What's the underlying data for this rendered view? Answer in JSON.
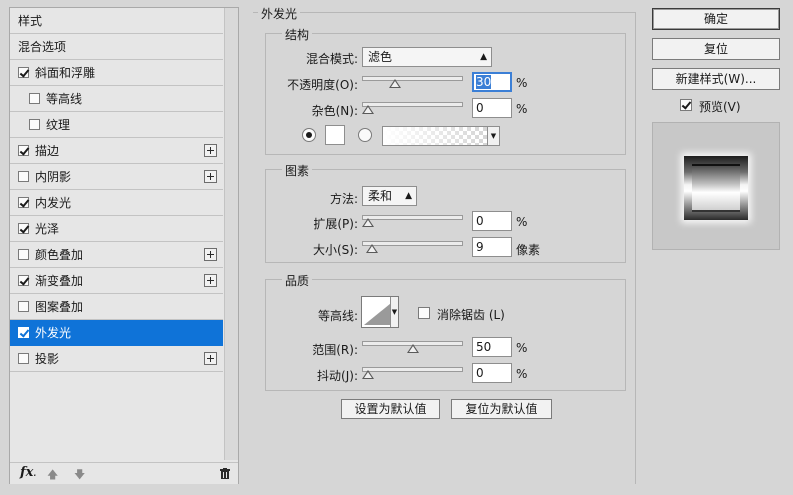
{
  "left_panel": {
    "items": [
      {
        "label": "样式",
        "has_checkbox": false,
        "checked": false,
        "has_plus": false,
        "indent": false,
        "selected": false
      },
      {
        "label": "混合选项",
        "has_checkbox": false,
        "checked": false,
        "has_plus": false,
        "indent": false,
        "selected": false
      },
      {
        "label": "斜面和浮雕",
        "has_checkbox": true,
        "checked": true,
        "has_plus": false,
        "indent": false,
        "selected": false
      },
      {
        "label": "等高线",
        "has_checkbox": true,
        "checked": false,
        "has_plus": false,
        "indent": true,
        "selected": false
      },
      {
        "label": "纹理",
        "has_checkbox": true,
        "checked": false,
        "has_plus": false,
        "indent": true,
        "selected": false
      },
      {
        "label": "描边",
        "has_checkbox": true,
        "checked": true,
        "has_plus": true,
        "indent": false,
        "selected": false
      },
      {
        "label": "内阴影",
        "has_checkbox": true,
        "checked": false,
        "has_plus": true,
        "indent": false,
        "selected": false
      },
      {
        "label": "内发光",
        "has_checkbox": true,
        "checked": true,
        "has_plus": false,
        "indent": false,
        "selected": false
      },
      {
        "label": "光泽",
        "has_checkbox": true,
        "checked": true,
        "has_plus": false,
        "indent": false,
        "selected": false
      },
      {
        "label": "颜色叠加",
        "has_checkbox": true,
        "checked": false,
        "has_plus": true,
        "indent": false,
        "selected": false
      },
      {
        "label": "渐变叠加",
        "has_checkbox": true,
        "checked": true,
        "has_plus": true,
        "indent": false,
        "selected": false
      },
      {
        "label": "图案叠加",
        "has_checkbox": true,
        "checked": false,
        "has_plus": false,
        "indent": false,
        "selected": false
      },
      {
        "label": "外发光",
        "has_checkbox": true,
        "checked": true,
        "has_plus": false,
        "indent": false,
        "selected": true
      },
      {
        "label": "投影",
        "has_checkbox": true,
        "checked": false,
        "has_plus": true,
        "indent": false,
        "selected": false
      }
    ],
    "footer": {
      "fx_label": "fx",
      "fx_sub": "."
    }
  },
  "outer_glow": {
    "title": "外发光",
    "structure": {
      "title": "结构",
      "blend_mode_label": "混合模式:",
      "blend_mode_value": "滤色",
      "opacity_label": "不透明度(O):",
      "opacity_value": "30",
      "opacity_fraction": 0.3,
      "noise_label": "杂色(N):",
      "noise_value": "0",
      "noise_fraction": 0.0,
      "percent": "%"
    },
    "elements": {
      "title": "图素",
      "method_label": "方法:",
      "method_value": "柔和",
      "spread_label": "扩展(P):",
      "spread_value": "0",
      "spread_fraction": 0.0,
      "size_label": "大小(S):",
      "size_value": "9",
      "size_fraction": 0.04,
      "size_unit": "像素",
      "percent": "%"
    },
    "quality": {
      "title": "品质",
      "contour_label": "等高线:",
      "antialias_label": "消除锯齿 (L)",
      "antialias_checked": false,
      "range_label": "范围(R):",
      "range_value": "50",
      "range_fraction": 0.5,
      "jitter_label": "抖动(J):",
      "jitter_value": "0",
      "jitter_fraction": 0.0,
      "percent": "%"
    },
    "set_default_label": "设置为默认值",
    "reset_default_label": "复位为默认值"
  },
  "right_panel": {
    "ok_label": "确定",
    "reset_label": "复位",
    "new_style_label": "新建样式(W)...",
    "preview_label": "预览(V)",
    "preview_checked": true
  },
  "colors": {
    "selected_row": "#0f73d8",
    "dialog_bg": "#d6d6d6",
    "focus_blue": "#3b7fd6"
  }
}
